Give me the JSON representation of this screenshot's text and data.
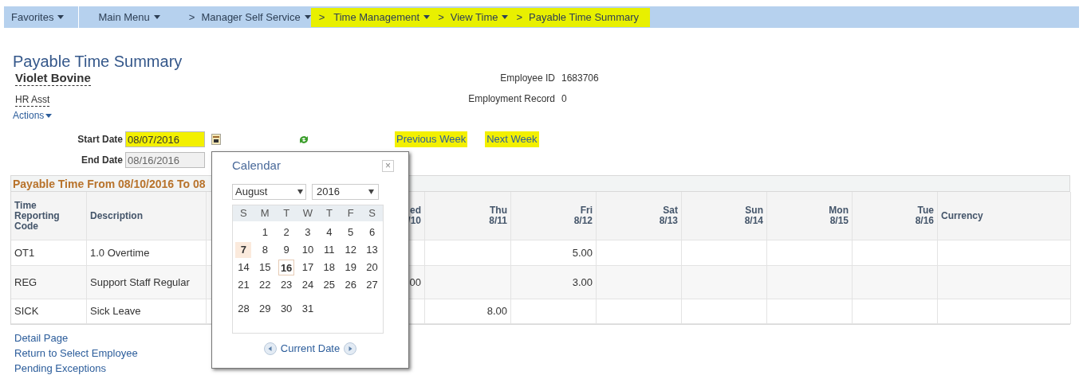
{
  "breadcrumb": [
    {
      "label": "Favorites",
      "dropdown": true,
      "highlighted": false,
      "divider_after": true
    },
    {
      "label": "Main Menu",
      "dropdown": true,
      "highlighted": false
    },
    {
      "separator": ">",
      "label": "Manager Self Service",
      "dropdown": true,
      "highlighted": false
    },
    {
      "separator": ">",
      "label": "Time Management",
      "dropdown": true,
      "highlighted": true
    },
    {
      "separator": ">",
      "label": "View Time",
      "dropdown": true,
      "highlighted": true
    },
    {
      "separator": ">",
      "label": "Payable Time Summary",
      "dropdown": false,
      "highlighted": true
    }
  ],
  "page": {
    "title": "Payable Time Summary",
    "employee_name": "Violet Bovine",
    "job_title": "HR Asst",
    "actions": "Actions",
    "employee_id_label": "Employee ID",
    "employee_id": "1683706",
    "employment_record_label": "Employment Record",
    "employment_record": "0"
  },
  "dates": {
    "start_label": "Start Date",
    "start_value": "08/07/2016",
    "start_highlighted": true,
    "end_label": "End Date",
    "end_value": "08/16/2016",
    "end_disabled": true
  },
  "week_links": [
    {
      "label": "Previous Week",
      "highlighted": true
    },
    {
      "label": "Next Week",
      "highlighted": true
    }
  ],
  "table": {
    "title": "Payable Time From 08/10/2016 To 08",
    "columns": [
      {
        "lines": [
          "Time",
          "Reporting",
          "Code"
        ]
      },
      {
        "lines": [
          "Description"
        ]
      },
      {
        "lines": [
          "ed",
          "/10"
        ]
      },
      {
        "lines": [
          "Thu",
          "8/11"
        ]
      },
      {
        "lines": [
          "Fri",
          "8/12"
        ]
      },
      {
        "lines": [
          "Sat",
          "8/13"
        ]
      },
      {
        "lines": [
          "Sun",
          "8/14"
        ]
      },
      {
        "lines": [
          "Mon",
          "8/15"
        ]
      },
      {
        "lines": [
          "Tue",
          "8/16"
        ]
      },
      {
        "lines": [
          "Currency"
        ]
      }
    ],
    "rows": [
      {
        "cells": [
          "OT1",
          "1.0 Overtime",
          null,
          null,
          "5.00",
          null,
          null,
          null,
          null,
          null
        ]
      },
      {
        "cells": [
          "REG",
          "Support Staff Regular",
          "00",
          null,
          "3.00",
          null,
          null,
          null,
          null,
          null
        ]
      },
      {
        "cells": [
          "SICK",
          "Sick Leave",
          null,
          "8.00",
          null,
          null,
          null,
          null,
          null,
          null
        ]
      }
    ]
  },
  "links": [
    {
      "label": "Detail Page"
    },
    {
      "label": "Return to Select Employee"
    },
    {
      "label": "Pending Exceptions"
    }
  ],
  "calendar": {
    "title": "Calendar",
    "close": "×",
    "month": "August",
    "year": "2016",
    "weekdays": [
      "S",
      "M",
      "T",
      "W",
      "T",
      "F",
      "S"
    ],
    "weeks": [
      [
        {
          "label": "1",
          "selected": false,
          "today": false
        },
        {
          "label": "2",
          "selected": false,
          "today": false
        },
        {
          "label": "3",
          "selected": false,
          "today": false
        },
        {
          "label": "4",
          "selected": false,
          "today": false
        },
        {
          "label": "5",
          "selected": false,
          "today": false
        },
        {
          "label": "6",
          "selected": false,
          "today": false
        }
      ],
      [
        {
          "label": "7",
          "selected": true,
          "today": false
        },
        {
          "label": "8",
          "selected": false,
          "today": false
        },
        {
          "label": "9",
          "selected": false,
          "today": false
        },
        {
          "label": "10",
          "selected": false,
          "today": false
        },
        {
          "label": "11",
          "selected": false,
          "today": false
        },
        {
          "label": "12",
          "selected": false,
          "today": false
        },
        {
          "label": "13",
          "selected": false,
          "today": false
        }
      ],
      [
        {
          "label": "14",
          "selected": false,
          "today": false
        },
        {
          "label": "15",
          "selected": false,
          "today": false
        },
        {
          "label": "16",
          "selected": false,
          "today": true
        },
        {
          "label": "17",
          "selected": false,
          "today": false
        },
        {
          "label": "18",
          "selected": false,
          "today": false
        },
        {
          "label": "19",
          "selected": false,
          "today": false
        },
        {
          "label": "20",
          "selected": false,
          "today": false
        }
      ],
      [
        {
          "label": "21",
          "selected": false,
          "today": false
        },
        {
          "label": "22",
          "selected": false,
          "today": false
        },
        {
          "label": "23",
          "selected": false,
          "today": false
        },
        {
          "label": "24",
          "selected": false,
          "today": false
        },
        {
          "label": "25",
          "selected": false,
          "today": false
        },
        {
          "label": "26",
          "selected": false,
          "today": false
        },
        {
          "label": "27",
          "selected": false,
          "today": false
        }
      ],
      [
        {
          "label": "28",
          "selected": false,
          "today": false
        },
        {
          "label": "29",
          "selected": false,
          "today": false
        },
        {
          "label": "30",
          "selected": false,
          "today": false
        },
        {
          "label": "31",
          "selected": false,
          "today": false
        }
      ]
    ],
    "current_date": "Current Date"
  }
}
